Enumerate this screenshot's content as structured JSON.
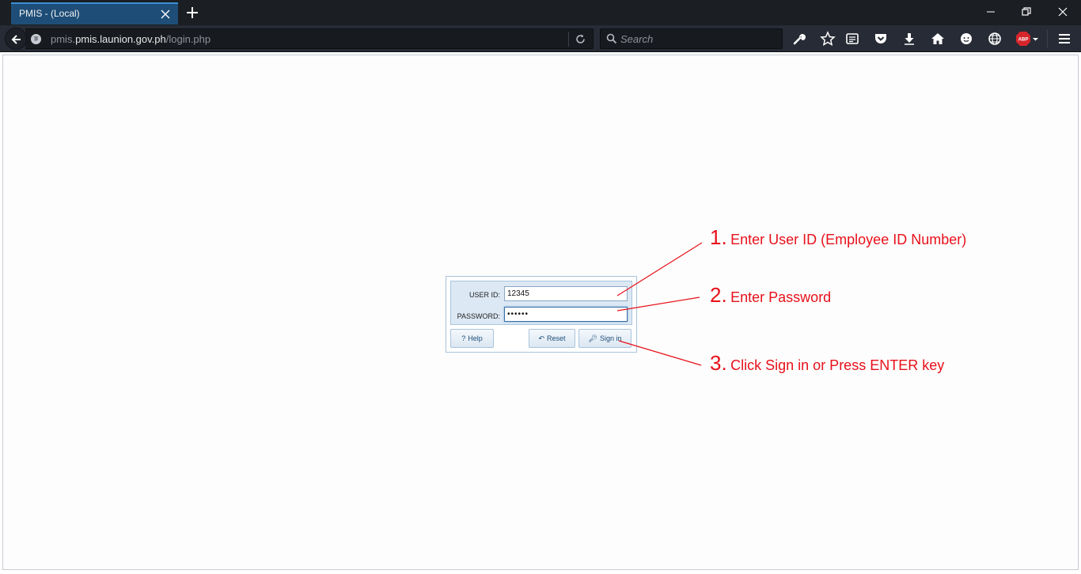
{
  "browser": {
    "tab_title": "PMIS - (Local)",
    "url_host": "pmis.launion.gov.ph",
    "url_path": "/login.php",
    "url_prefix": "pmis.",
    "search_placeholder": "Search",
    "adblock_label": "ABP",
    "accent_color": "#1e4e77"
  },
  "toolbar_icons": [
    "wrench-icon",
    "star-icon",
    "reader-icon",
    "pocket-icon",
    "download-icon",
    "home-icon",
    "chat-icon",
    "globe-icon",
    "adblock-icon",
    "menu-icon"
  ],
  "login": {
    "userid_label": "USER ID:",
    "userid_value": "12345",
    "password_label": "PASSWORD:",
    "password_value": "••••••",
    "help_label": "Help",
    "reset_label": "Reset",
    "signin_label": "Sign in"
  },
  "annotations": [
    {
      "number": "1.",
      "text": "Enter User ID (Employee ID Number)"
    },
    {
      "number": "2.",
      "text": "Enter Password"
    },
    {
      "number": "3.",
      "text": "Click Sign in or Press ENTER key"
    }
  ],
  "annotation_color": "#e8101a"
}
